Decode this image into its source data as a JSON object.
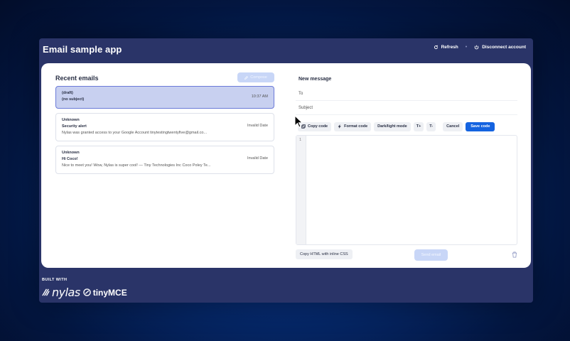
{
  "app": {
    "title": "Email sample app",
    "refresh_label": "Refresh",
    "separator": "•",
    "disconnect_label": "Disconnect account"
  },
  "inbox": {
    "title": "Recent emails",
    "compose_label": "Compose",
    "emails": [
      {
        "from": "(draft)",
        "subject": "(no subject)",
        "snippet": "",
        "date": "10:37 AM"
      },
      {
        "from": "Unknown",
        "subject": "Security alert",
        "snippet": "Nylas was granted access to your Google Account tinytestingtwentyfive@gmail.co...",
        "date": "Invalid Date"
      },
      {
        "from": "Unknown",
        "subject": "Hi Coco!",
        "snippet": "Nice to meet you! Wow, Nylas is super cool! — Tiny Technologies Inc Coco Poley Te...",
        "date": "Invalid Date"
      }
    ]
  },
  "composer": {
    "title": "New message",
    "to_label": "To",
    "subject_label": "Subject",
    "toolbar": {
      "copy_code": "Copy code",
      "format_code": "Format code",
      "dark_light_mode": "Dark/light mode",
      "font_increase": "T+",
      "font_decrease": "T-",
      "cancel": "Cancel",
      "save_code": "Save code"
    },
    "line_number": "1",
    "copy_html_label": "Copy HTML with inline CSS",
    "send_label": "Send email"
  },
  "footer": {
    "built_with": "BUILT WITH",
    "nylas_logo": "nylas",
    "tiny_logo": "tinyMCE"
  },
  "colors": {
    "app_bg": "#2a3468",
    "accent": "#1463e0",
    "selected_email_bg": "#c8d0f0"
  }
}
